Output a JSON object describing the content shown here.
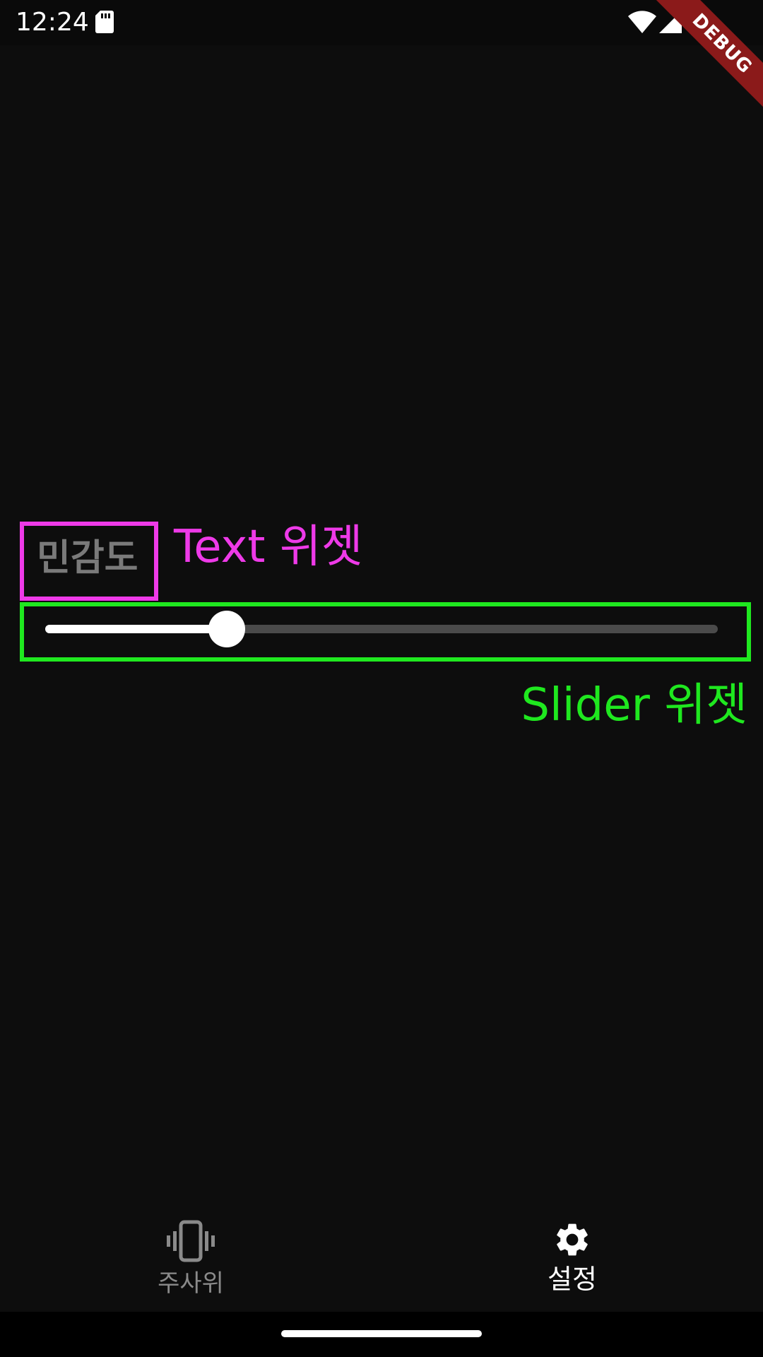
{
  "status_bar": {
    "time": "12:24",
    "icons": [
      "sd-card-icon",
      "wifi-icon",
      "cell-signal-icon",
      "battery-icon"
    ]
  },
  "debug_banner": {
    "label": "DEBUG",
    "color": "#8b1a1a"
  },
  "content": {
    "sensitivity_label": "민감도",
    "slider": {
      "value": 0.27,
      "active_color": "#ffffff",
      "inactive_color": "#4a4a4a"
    }
  },
  "annotations": {
    "text_widget": {
      "caption": "Text 위젯",
      "color": "#ee3ae8"
    },
    "slider_widget": {
      "caption": "Slider 위젯",
      "color": "#1fe81f"
    }
  },
  "bottom_nav": {
    "items": [
      {
        "label": "주사위",
        "icon": "phone-vibrate-icon",
        "selected": false
      },
      {
        "label": "설정",
        "icon": "gear-icon",
        "selected": true
      }
    ]
  }
}
